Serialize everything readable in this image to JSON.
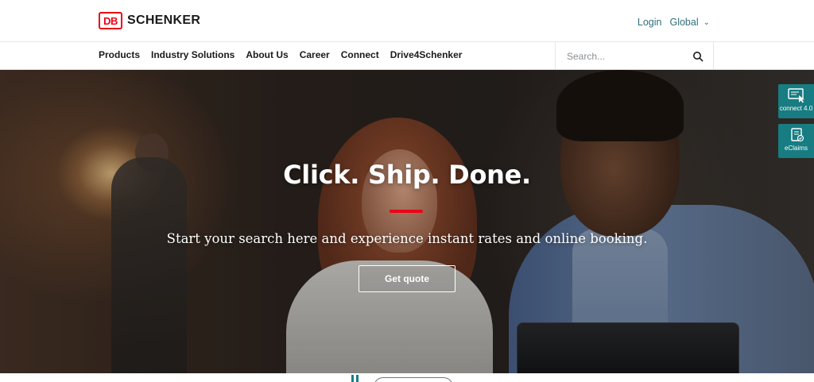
{
  "brand": {
    "logo_mark": "DB",
    "name": "SCHENKER",
    "accent": "#ec0016",
    "teal": "#177d82"
  },
  "header": {
    "login": "Login",
    "region": "Global",
    "region_icon": "chevron-down-icon"
  },
  "nav": {
    "items": [
      {
        "label": "Products"
      },
      {
        "label": "Industry Solutions"
      },
      {
        "label": "About Us"
      },
      {
        "label": "Career"
      },
      {
        "label": "Connect"
      },
      {
        "label": "Drive4Schenker"
      }
    ],
    "search": {
      "placeholder": "Search...",
      "value": "",
      "icon": "search-icon"
    }
  },
  "hero": {
    "title": "Click. Ship. Done.",
    "subtitle": "Start your search here and experience instant rates and online booking.",
    "cta": "Get quote"
  },
  "side_widgets": [
    {
      "label": "connect 4.0",
      "icon": "computer-cursor-icon"
    },
    {
      "label": "eClaims",
      "icon": "claims-document-icon"
    }
  ]
}
